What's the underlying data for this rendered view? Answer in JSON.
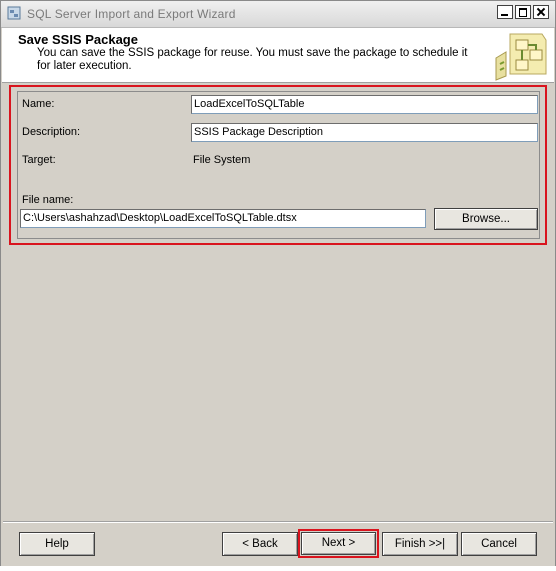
{
  "window": {
    "title": "SQL Server Import and Export Wizard"
  },
  "header": {
    "title": "Save SSIS Package",
    "description": "You can save the SSIS package for reuse. You must save the package to schedule it for later execution."
  },
  "form": {
    "name_label": "Name:",
    "name_value": "LoadExcelToSQLTable",
    "description_label": "Description:",
    "description_value": "SSIS Package Description",
    "target_label": "Target:",
    "target_value": "File System",
    "filename_label": "File name:",
    "filename_value": "C:\\Users\\ashahzad\\Desktop\\LoadExcelToSQLTable.dtsx",
    "browse_label": "Browse..."
  },
  "buttons": {
    "help": "Help",
    "back": "< Back",
    "next": "Next >",
    "finish": "Finish >>|",
    "cancel": "Cancel"
  },
  "colors": {
    "highlight": "#d9141e",
    "dialog_bg": "#d4d0c8"
  },
  "icons": {
    "title": "wizard-app-icon",
    "header": "package-flow-icon"
  }
}
